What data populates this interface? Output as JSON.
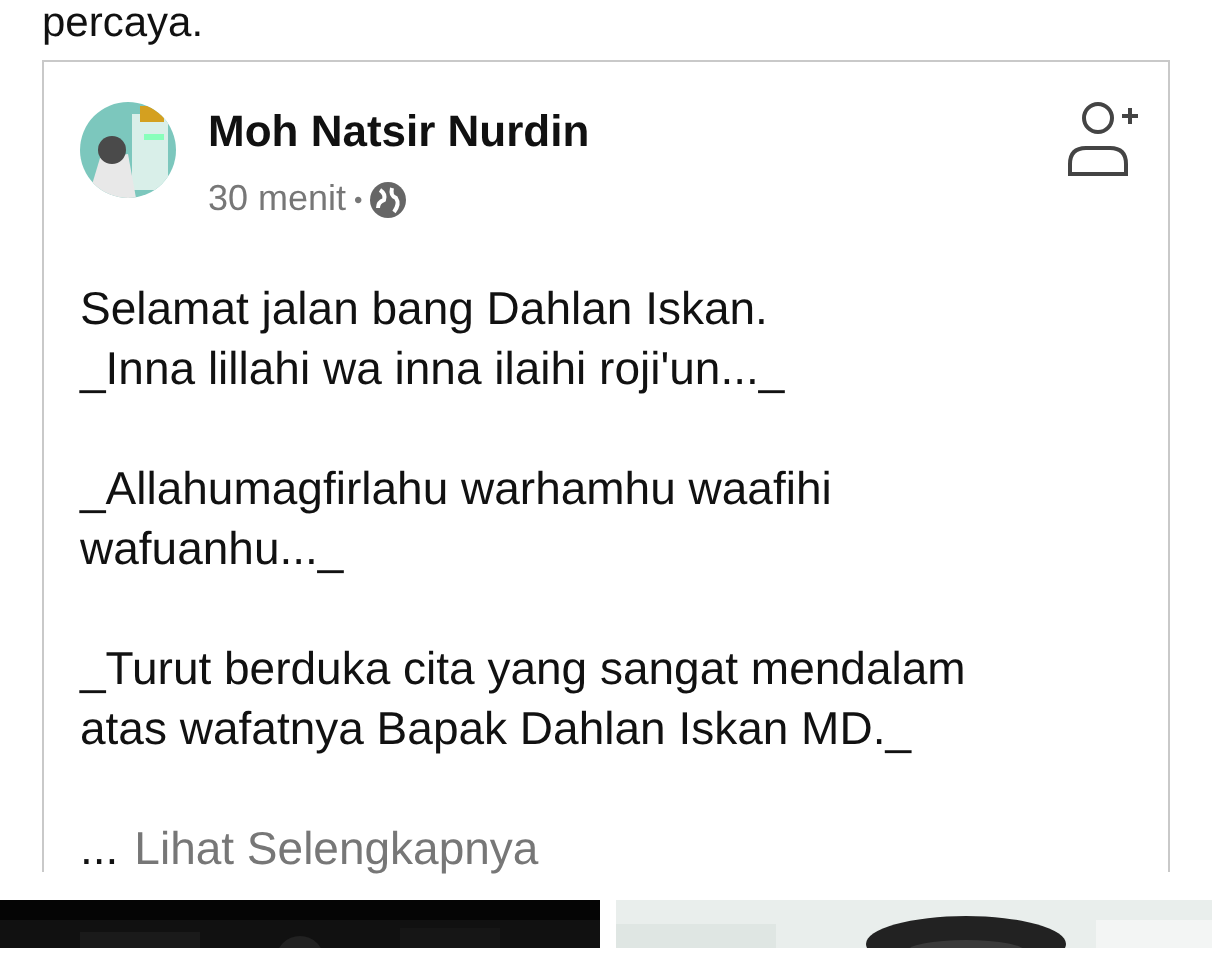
{
  "article_text": "percaya.",
  "post": {
    "author": "Moh Natsir Nurdin",
    "time": "30 menit",
    "separator": "•",
    "paragraphs": [
      [
        "Selamat jalan bang Dahlan Iskan.",
        "_Inna lillahi wa inna ilaihi roji'un..._"
      ],
      [
        "_Allahumagfirlahu warhamhu waafihi",
        "wafuanhu..._"
      ],
      [
        "_Turut berduka cita yang sangat mendalam",
        "atas wafatnya Bapak Dahlan Iskan MD._"
      ]
    ],
    "ellipsis": "...",
    "see_more": "Lihat Selengkapnya"
  }
}
